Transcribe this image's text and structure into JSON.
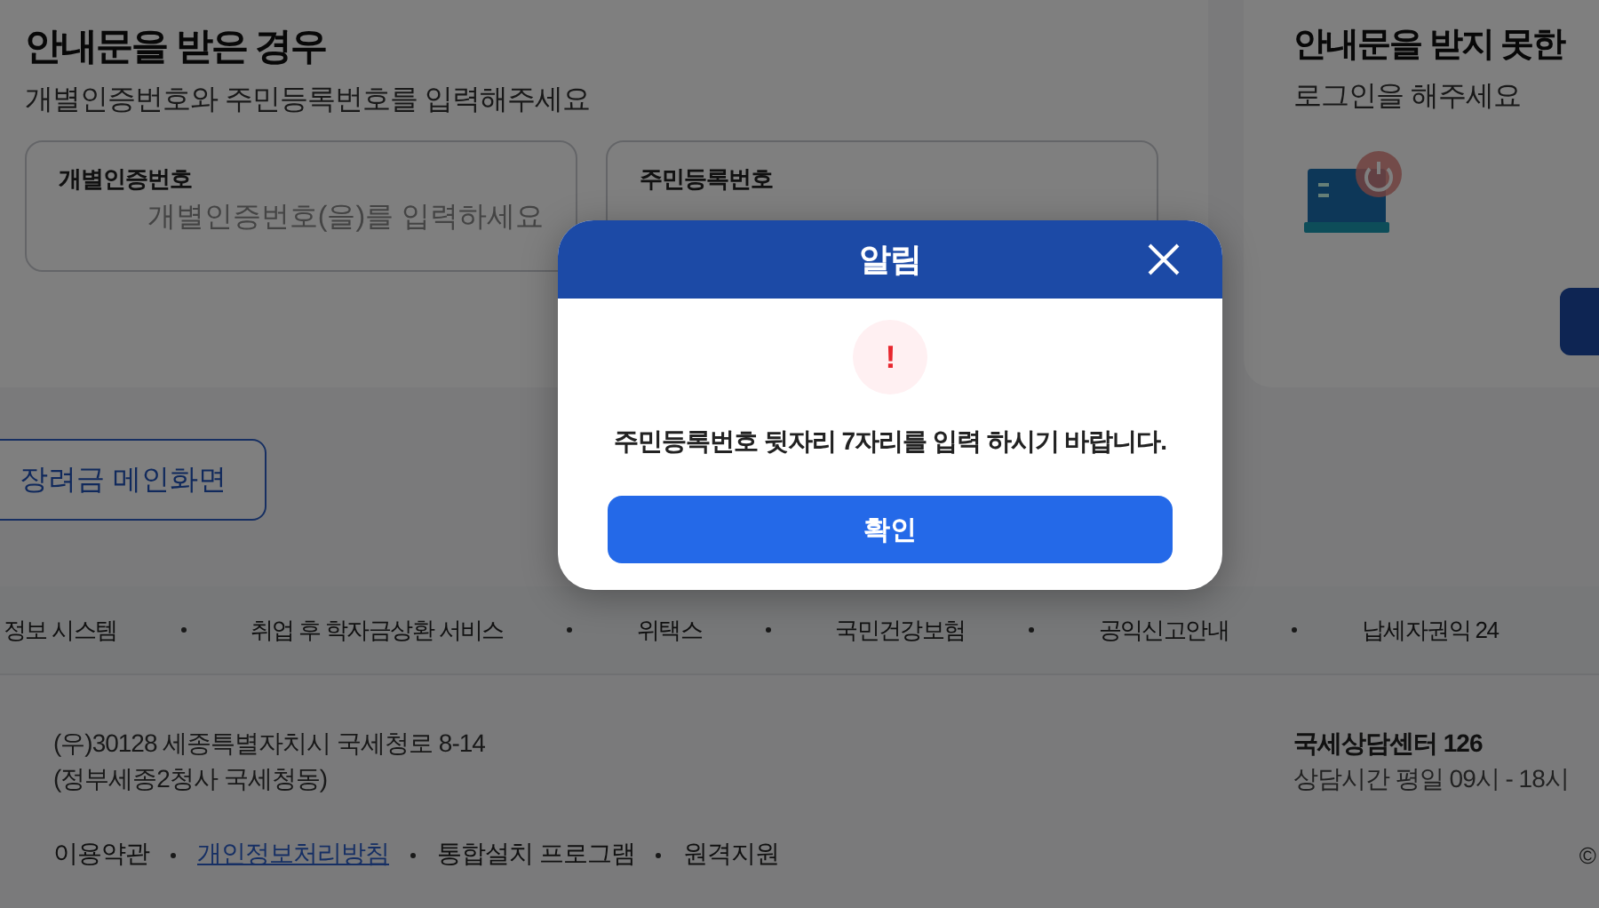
{
  "left_panel": {
    "title": "안내문을 받은 경우",
    "subtitle": "개별인증번호와 주민등록번호를 입력해주세요",
    "fields": [
      {
        "label": "개별인증번호",
        "placeholder": "개별인증번호(을)를 입력하세요"
      },
      {
        "label": "주민등록번호"
      }
    ]
  },
  "right_panel": {
    "title": "안내문을 받지 못한",
    "subtitle": "로그인을 해주세요"
  },
  "main_button": "장려금 메인화면",
  "footer_links": [
    "정보 시스템",
    "취업 후 학자금상환 서비스",
    "위택스",
    "국민건강보험",
    "공익신고안내",
    "납세자권익 24"
  ],
  "address": [
    "(우)30128 세종특별자치시 국세청로 8-14",
    "(정부세종2청사 국세청동)"
  ],
  "contact": {
    "title": "국세상담센터 126",
    "hours": "상담시간 평일 09시 - 18시"
  },
  "policy_links": [
    {
      "label": "이용약관",
      "highlighted": false
    },
    {
      "label": "개인정보처리방침",
      "highlighted": true
    },
    {
      "label": "통합설치 프로그램",
      "highlighted": false
    },
    {
      "label": "원격지원",
      "highlighted": false
    }
  ],
  "copyright": "©",
  "dialog": {
    "title": "알림",
    "icon": "!",
    "message": "주민등록번호 뒷자리 7자리를 입력 하시기 바랍니다.",
    "confirm": "확인"
  }
}
